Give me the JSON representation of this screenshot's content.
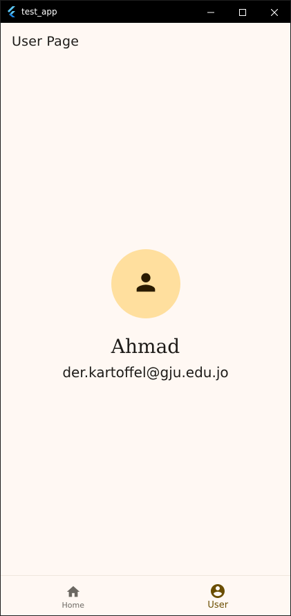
{
  "window": {
    "title": "test_app",
    "icon": "flutter-logo-icon",
    "controls": [
      "minimize-icon",
      "maximize-icon",
      "close-icon"
    ]
  },
  "appbar": {
    "title": "User Page"
  },
  "profile": {
    "avatar_icon": "person-icon",
    "name": "Ahmad",
    "email": "der.kartoffel@gju.edu.jo"
  },
  "bottom_nav": {
    "items": [
      {
        "label": "Home",
        "icon": "home-icon",
        "selected": false
      },
      {
        "label": "User",
        "icon": "account-circle-icon",
        "selected": true
      }
    ]
  },
  "colors": {
    "background": "#fff8f3",
    "avatar_bg": "#ffdf9e",
    "text": "#1d1b18",
    "nav_selected": "#6b4e00",
    "nav_unselected": "#6c6862",
    "titlebar": "#000000"
  }
}
